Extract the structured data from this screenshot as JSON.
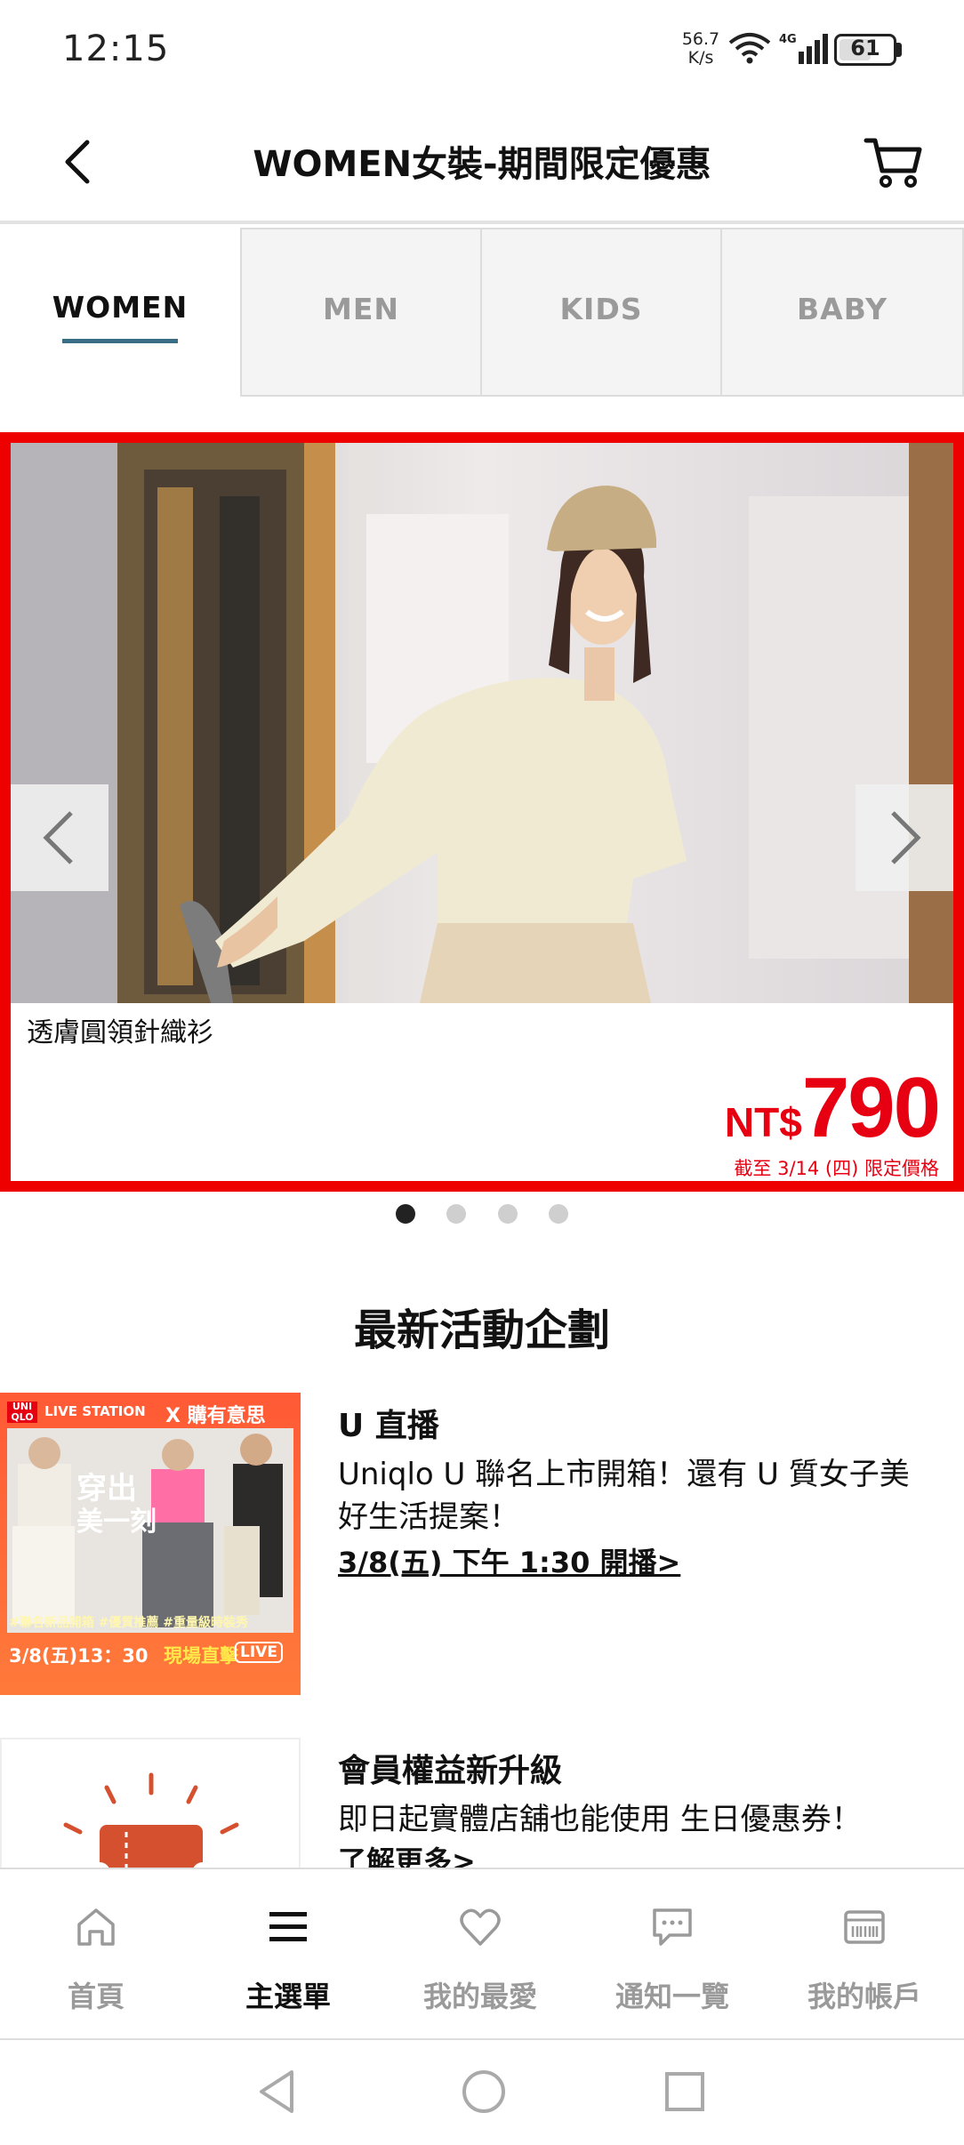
{
  "status_bar": {
    "time": "12:15",
    "net_speed_value": "56.7",
    "net_speed_unit": "K/s",
    "battery": "61",
    "battery_level_fraction": 0.61,
    "icons": [
      "wifi-icon",
      "signal-4g-icon",
      "battery-icon"
    ]
  },
  "header": {
    "title": "WOMEN女裝-期間限定優惠",
    "back_icon": "chevron-left-icon",
    "cart_icon": "cart-icon"
  },
  "tabs": [
    {
      "label": "WOMEN",
      "active": true
    },
    {
      "label": "MEN",
      "active": false
    },
    {
      "label": "KIDS",
      "active": false
    },
    {
      "label": "BABY",
      "active": false
    }
  ],
  "carousel": {
    "product_name": "透膚圓領針織衫",
    "price_currency": "NT$",
    "price_amount": "790",
    "price_note": "截至 3/14 (四) 限定價格",
    "current_slide": 1,
    "total_slides": 4,
    "accent_color": "#ee0000",
    "price_color": "#e60012"
  },
  "section": {
    "title": "最新活動企劃"
  },
  "promos": [
    {
      "heading": "U 直播",
      "text": "Uniqlo U 聯名上市開箱！還有 U 質女子美好生活提案！",
      "link": "3/8(五) 下午 1:30 開播>",
      "thumb": {
        "brand": "UNI QLO",
        "station": "LIVE STATION",
        "collab": "X 購有意思",
        "headline_1": "穿出",
        "headline_2": "美一刻",
        "tags": "#聯名新品開箱 #優質推薦 #重量級時裝秀",
        "date": "3/8(五)13：30",
        "cta": "現場直擊",
        "live": "LIVE"
      }
    },
    {
      "heading": "會員權益新升級",
      "text": "即日起實體店舖也能使用 生日優惠券！",
      "link": "了解更多>"
    }
  ],
  "bottom_nav": [
    {
      "label": "首頁",
      "icon": "home-icon",
      "active": false
    },
    {
      "label": "主選單",
      "icon": "menu-icon",
      "active": true
    },
    {
      "label": "我的最愛",
      "icon": "heart-icon",
      "active": false
    },
    {
      "label": "通知一覽",
      "icon": "chat-icon",
      "active": false
    },
    {
      "label": "我的帳戶",
      "icon": "member-card-icon",
      "active": false
    }
  ],
  "system_nav": [
    "back-triangle-icon",
    "home-circle-icon",
    "recents-square-icon"
  ]
}
